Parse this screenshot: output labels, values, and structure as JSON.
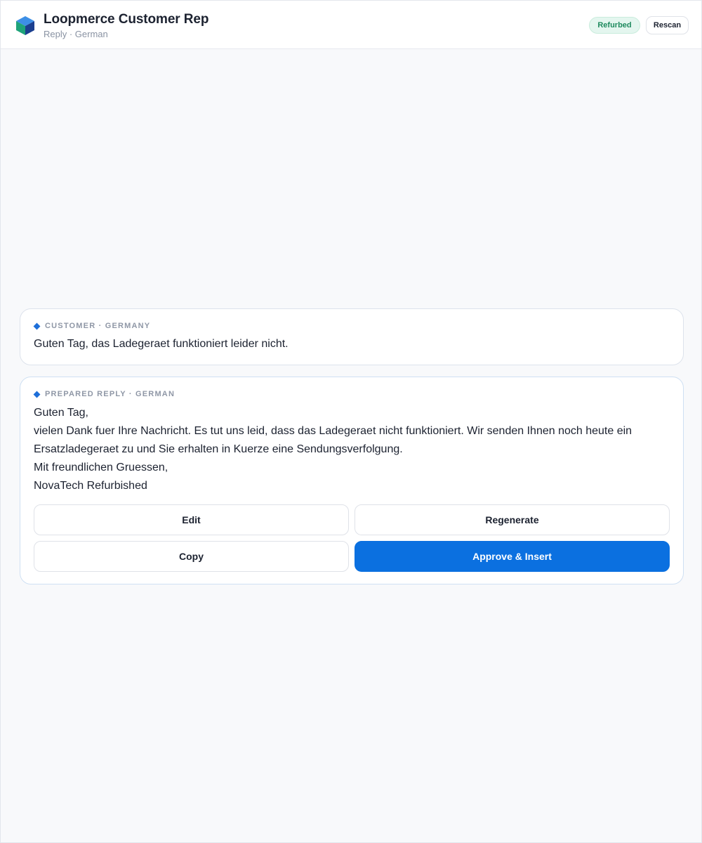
{
  "header": {
    "title": "Loopmerce Customer Rep",
    "subtitle": "Reply · German",
    "badge": "Refurbed",
    "rescan_label": "Rescan",
    "logo_icon": "cube-logo-icon"
  },
  "customer": {
    "label": "CUSTOMER · GERMANY",
    "message": "Guten Tag, das Ladegeraet funktioniert leider nicht."
  },
  "reply": {
    "label": "PREPARED REPLY · GERMAN",
    "lines": [
      "Guten Tag,",
      "vielen Dank fuer Ihre Nachricht. Es tut uns leid, dass das Ladegeraet nicht funktioniert. Wir senden Ihnen noch heute ein Ersatzladegeraet zu und Sie erhalten in Kuerze eine Sendungsverfolgung.",
      "Mit freundlichen Gruessen,",
      "NovaTech Refurbished"
    ],
    "buttons": {
      "edit": "Edit",
      "regenerate": "Regenerate",
      "copy": "Copy",
      "approve": "Approve & Insert"
    }
  },
  "colors": {
    "accent": "#0b70e0",
    "badge_text": "#1e8a5e",
    "badge_bg": "#e4f6ef"
  }
}
